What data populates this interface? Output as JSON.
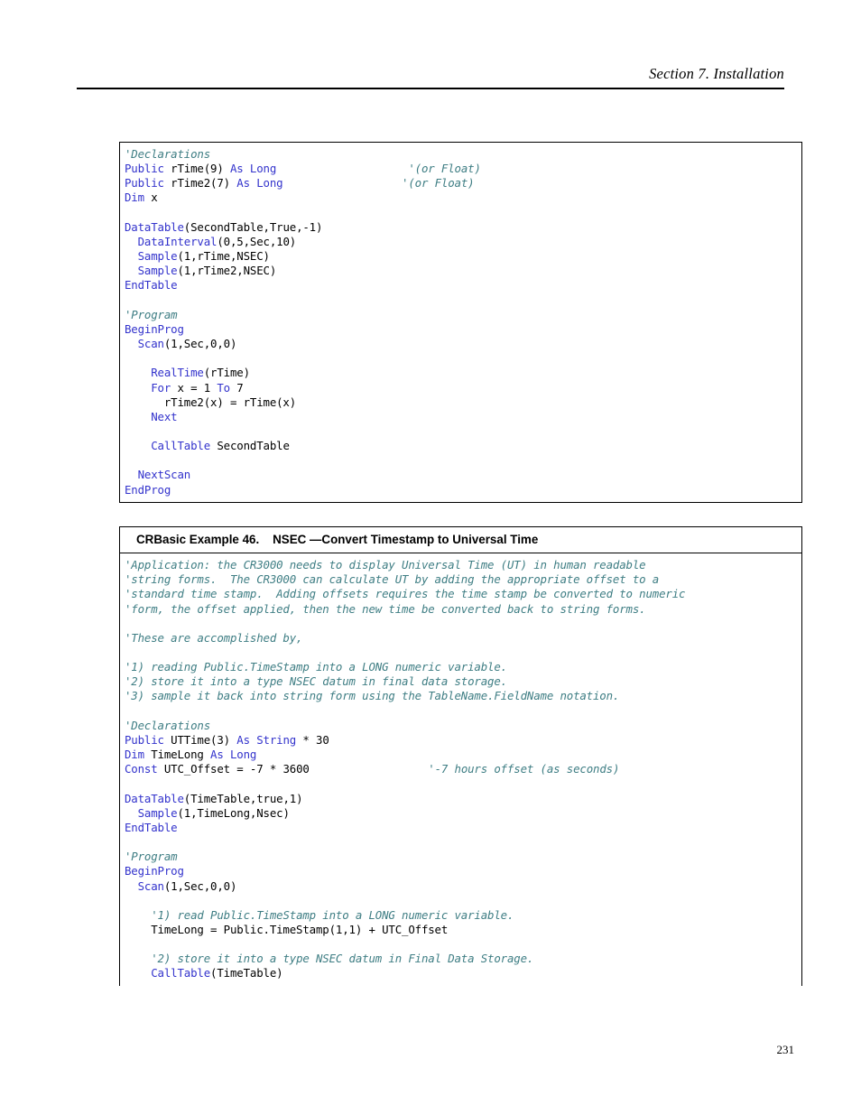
{
  "page": {
    "header_title": "Section 7.  Installation",
    "page_number": "231"
  },
  "examples": [
    {
      "name": "realtime-nsec-example",
      "caption": null,
      "code_lines": [
        [
          {
            "t": "cm",
            "s": "'Declarations"
          }
        ],
        [
          {
            "t": "k",
            "s": "Public"
          },
          {
            "t": "pl",
            "s": " rTime(9) "
          },
          {
            "t": "k",
            "s": "As Long"
          },
          {
            "t": "pl",
            "s": "                    "
          },
          {
            "t": "cm",
            "s": "'(or Float)"
          }
        ],
        [
          {
            "t": "k",
            "s": "Public"
          },
          {
            "t": "pl",
            "s": " rTime2(7) "
          },
          {
            "t": "k",
            "s": "As Long"
          },
          {
            "t": "pl",
            "s": "                  "
          },
          {
            "t": "cm",
            "s": "'(or Float)"
          }
        ],
        [
          {
            "t": "k",
            "s": "Dim"
          },
          {
            "t": "pl",
            "s": " x"
          }
        ],
        [
          {
            "t": "pl",
            "s": ""
          }
        ],
        [
          {
            "t": "k",
            "s": "DataTable"
          },
          {
            "t": "pl",
            "s": "(SecondTable,True,-1)"
          }
        ],
        [
          {
            "t": "pl",
            "s": "  "
          },
          {
            "t": "k",
            "s": "DataInterval"
          },
          {
            "t": "pl",
            "s": "(0,5,Sec,10)"
          }
        ],
        [
          {
            "t": "pl",
            "s": "  "
          },
          {
            "t": "k",
            "s": "Sample"
          },
          {
            "t": "pl",
            "s": "(1,rTime,NSEC)"
          }
        ],
        [
          {
            "t": "pl",
            "s": "  "
          },
          {
            "t": "k",
            "s": "Sample"
          },
          {
            "t": "pl",
            "s": "(1,rTime2,NSEC)"
          }
        ],
        [
          {
            "t": "k",
            "s": "EndTable"
          }
        ],
        [
          {
            "t": "pl",
            "s": ""
          }
        ],
        [
          {
            "t": "cm",
            "s": "'Program"
          }
        ],
        [
          {
            "t": "k",
            "s": "BeginProg"
          }
        ],
        [
          {
            "t": "pl",
            "s": "  "
          },
          {
            "t": "k",
            "s": "Scan"
          },
          {
            "t": "pl",
            "s": "(1,Sec,0,0)"
          }
        ],
        [
          {
            "t": "pl",
            "s": ""
          }
        ],
        [
          {
            "t": "pl",
            "s": "    "
          },
          {
            "t": "k",
            "s": "RealTime"
          },
          {
            "t": "pl",
            "s": "(rTime)"
          }
        ],
        [
          {
            "t": "pl",
            "s": "    "
          },
          {
            "t": "k",
            "s": "For"
          },
          {
            "t": "pl",
            "s": " x = 1 "
          },
          {
            "t": "k",
            "s": "To"
          },
          {
            "t": "pl",
            "s": " 7"
          }
        ],
        [
          {
            "t": "pl",
            "s": "      rTime2(x) = rTime(x)"
          }
        ],
        [
          {
            "t": "pl",
            "s": "    "
          },
          {
            "t": "k",
            "s": "Next"
          }
        ],
        [
          {
            "t": "pl",
            "s": ""
          }
        ],
        [
          {
            "t": "pl",
            "s": "    "
          },
          {
            "t": "k",
            "s": "CallTable"
          },
          {
            "t": "pl",
            "s": " SecondTable"
          }
        ],
        [
          {
            "t": "pl",
            "s": ""
          }
        ],
        [
          {
            "t": "pl",
            "s": "  "
          },
          {
            "t": "k",
            "s": "NextScan"
          }
        ],
        [
          {
            "t": "k",
            "s": "EndProg"
          }
        ]
      ]
    },
    {
      "name": "nsec-universal-time-example",
      "caption": "CRBasic Example 46.    NSEC —Convert Timestamp to Universal Time",
      "code_lines": [
        [
          {
            "t": "cm",
            "s": "'Application: the CR3000 needs to display Universal Time (UT) in human readable"
          }
        ],
        [
          {
            "t": "cm",
            "s": "'string forms.  The CR3000 can calculate UT by adding the appropriate offset to a"
          }
        ],
        [
          {
            "t": "cm",
            "s": "'standard time stamp.  Adding offsets requires the time stamp be converted to numeric"
          }
        ],
        [
          {
            "t": "cm",
            "s": "'form, the offset applied, then the new time be converted back to string forms."
          }
        ],
        [
          {
            "t": "pl",
            "s": ""
          }
        ],
        [
          {
            "t": "cm",
            "s": "'These are accomplished by,"
          }
        ],
        [
          {
            "t": "pl",
            "s": ""
          }
        ],
        [
          {
            "t": "cm",
            "s": "'1) reading Public.TimeStamp into a LONG numeric variable."
          }
        ],
        [
          {
            "t": "cm",
            "s": "'2) store it into a type NSEC datum in final data storage."
          }
        ],
        [
          {
            "t": "cm",
            "s": "'3) sample it back into string form using the TableName.FieldName notation."
          }
        ],
        [
          {
            "t": "pl",
            "s": ""
          }
        ],
        [
          {
            "t": "cm",
            "s": "'Declarations"
          }
        ],
        [
          {
            "t": "k",
            "s": "Public"
          },
          {
            "t": "pl",
            "s": " UTTime(3) "
          },
          {
            "t": "k",
            "s": "As String"
          },
          {
            "t": "pl",
            "s": " * 30"
          }
        ],
        [
          {
            "t": "k",
            "s": "Dim"
          },
          {
            "t": "pl",
            "s": " TimeLong "
          },
          {
            "t": "k",
            "s": "As Long"
          }
        ],
        [
          {
            "t": "k",
            "s": "Const"
          },
          {
            "t": "pl",
            "s": " UTC_Offset = -7 * 3600                  "
          },
          {
            "t": "cm",
            "s": "'-7 hours offset (as seconds)"
          }
        ],
        [
          {
            "t": "pl",
            "s": ""
          }
        ],
        [
          {
            "t": "k",
            "s": "DataTable"
          },
          {
            "t": "pl",
            "s": "(TimeTable,true,1)"
          }
        ],
        [
          {
            "t": "pl",
            "s": "  "
          },
          {
            "t": "k",
            "s": "Sample"
          },
          {
            "t": "pl",
            "s": "(1,TimeLong,Nsec)"
          }
        ],
        [
          {
            "t": "k",
            "s": "EndTable"
          }
        ],
        [
          {
            "t": "pl",
            "s": ""
          }
        ],
        [
          {
            "t": "cm",
            "s": "'Program"
          }
        ],
        [
          {
            "t": "k",
            "s": "BeginProg"
          }
        ],
        [
          {
            "t": "pl",
            "s": "  "
          },
          {
            "t": "k",
            "s": "Scan"
          },
          {
            "t": "pl",
            "s": "(1,Sec,0,0)"
          }
        ],
        [
          {
            "t": "pl",
            "s": ""
          }
        ],
        [
          {
            "t": "pl",
            "s": "    "
          },
          {
            "t": "cm",
            "s": "'1) read Public.TimeStamp into a LONG numeric variable."
          }
        ],
        [
          {
            "t": "pl",
            "s": "    TimeLong = Public.TimeStamp(1,1) + UTC_Offset"
          }
        ],
        [
          {
            "t": "pl",
            "s": ""
          }
        ],
        [
          {
            "t": "pl",
            "s": "    "
          },
          {
            "t": "cm",
            "s": "'2) store it into a type NSEC datum in Final Data Storage."
          }
        ],
        [
          {
            "t": "pl",
            "s": "    "
          },
          {
            "t": "k",
            "s": "CallTable"
          },
          {
            "t": "pl",
            "s": "(TimeTable)"
          }
        ],
        [
          {
            "t": "pl",
            "s": ""
          }
        ]
      ]
    }
  ],
  "colors": {
    "keyword": "#3333cc",
    "comment": "#3f7e84",
    "plain": "#000000",
    "rule": "#000000"
  }
}
